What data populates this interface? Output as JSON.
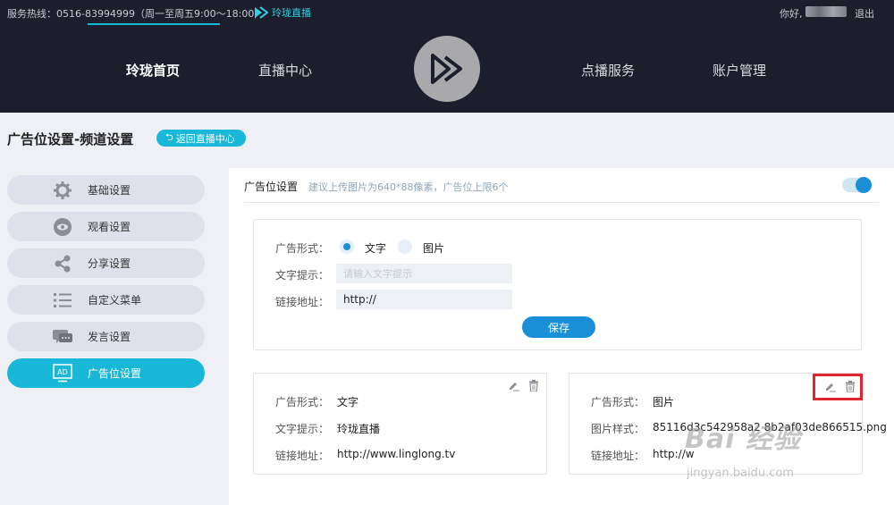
{
  "topbar": {
    "hotline": "服务热线：0516-83994999（周一至周五9:00～18:00）",
    "brand": "玲珑直播",
    "greeting": "你好,",
    "logout": "退出"
  },
  "nav": {
    "items": [
      "玲珑首页",
      "直播中心",
      "点播服务",
      "账户管理"
    ]
  },
  "header": {
    "title": "广告位设置-频道设置",
    "back_label": "返回直播中心"
  },
  "sidebar": {
    "items": [
      {
        "label": "基础设置",
        "icon": "gear-icon"
      },
      {
        "label": "观看设置",
        "icon": "eye-icon"
      },
      {
        "label": "分享设置",
        "icon": "share-icon"
      },
      {
        "label": "自定义菜单",
        "icon": "menu-list-icon"
      },
      {
        "label": "发言设置",
        "icon": "chat-icon"
      },
      {
        "label": "广告位设置",
        "icon": "ad-icon"
      }
    ],
    "active_index": 5
  },
  "panel": {
    "title": "广告位设置",
    "hint": "建议上传图片为640*88像素，广告位上限6个",
    "toggle_on": true
  },
  "form": {
    "type_label": "广告形式：",
    "option_text": "文字",
    "option_image": "图片",
    "selected": "文字",
    "tip_label": "文字提示：",
    "tip_placeholder": "请输入文字提示",
    "tip_value": "",
    "link_label": "链接地址：",
    "link_value": "http://",
    "save_label": "保存"
  },
  "cards": [
    {
      "rows": [
        {
          "label": "广告形式：",
          "value": "文字"
        },
        {
          "label": "文字提示：",
          "value": "玲珑直播"
        },
        {
          "label": "链接地址：",
          "value": "http://www.linglong.tv"
        }
      ]
    },
    {
      "rows": [
        {
          "label": "广告形式：",
          "value": "图片"
        },
        {
          "label": "图片样式：",
          "value": "85116d3c542958a2  8b2af03de866515.png"
        },
        {
          "label": "链接地址：",
          "value": "http://w"
        }
      ]
    }
  ],
  "watermark": {
    "main": "Bai 经验",
    "sub": "jingyan.baidu.com"
  },
  "colors": {
    "nav_bg": "#1d1e2c",
    "accent": "#1ab8d8",
    "primary_blue": "#1a8fd8",
    "highlight_red": "#e2252c"
  }
}
